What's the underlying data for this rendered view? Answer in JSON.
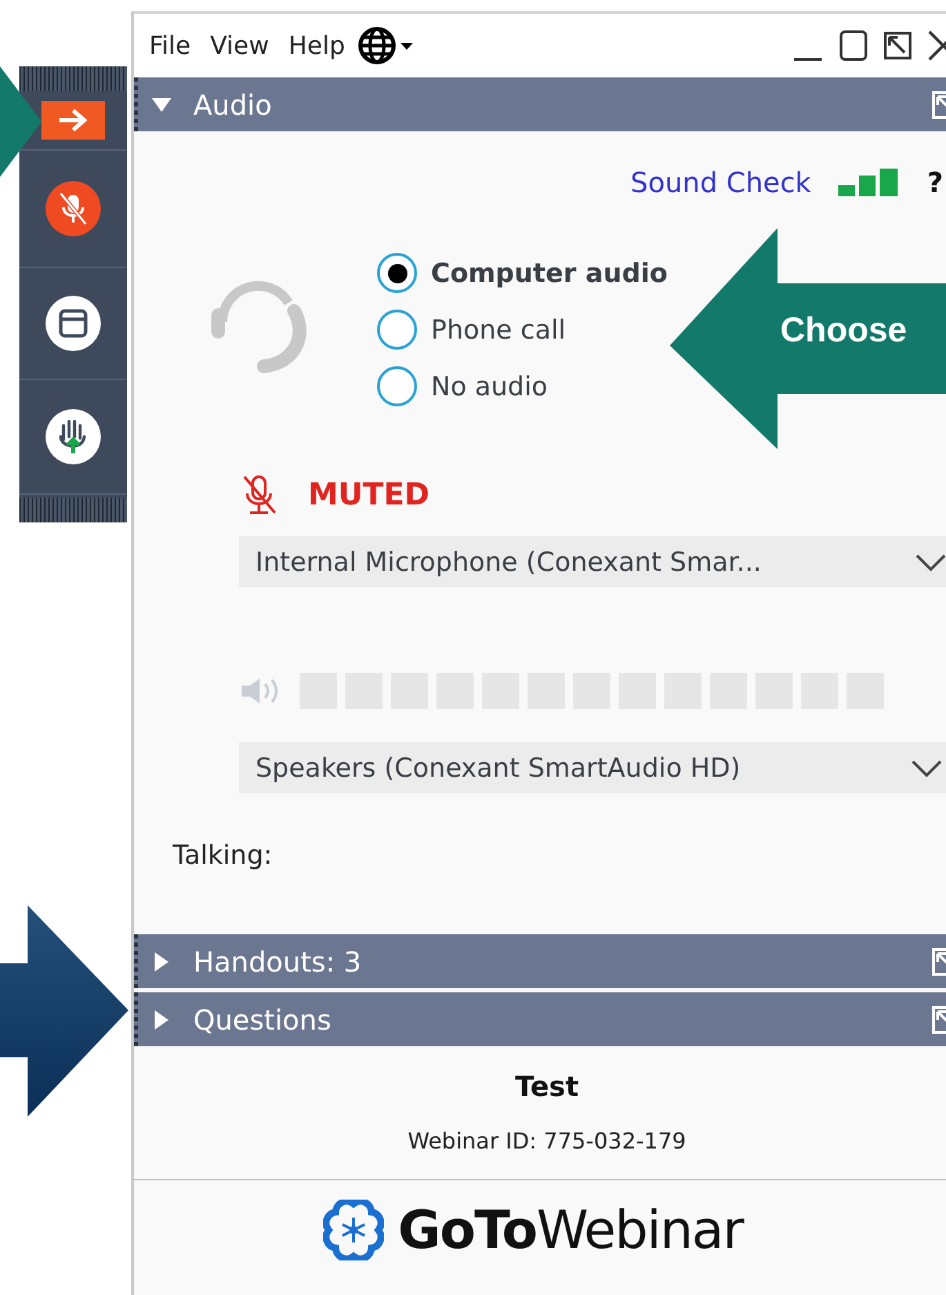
{
  "menu": [
    "File",
    "View",
    "Help"
  ],
  "sections": [
    {
      "title": "Audio",
      "expanded": true
    },
    {
      "title": "Handouts: 3",
      "expanded": false
    },
    {
      "title": "Questions",
      "expanded": false
    }
  ],
  "audio": {
    "sound_check": "Sound Check",
    "help": "?",
    "options": [
      {
        "label": "Computer audio",
        "selected": true
      },
      {
        "label": "Phone call",
        "selected": false
      },
      {
        "label": "No audio",
        "selected": false
      }
    ],
    "muted": true,
    "muted_label": "MUTED",
    "microphone": "Internal Microphone (Conexant Smar...",
    "speakers": "Speakers (Conexant SmartAudio HD)",
    "talking": "Talking:"
  },
  "webinar": {
    "title": "Test",
    "id": "Webinar ID: 775-032-179",
    "brand_bold": "GoTo",
    "brand_light": "Webinar"
  },
  "callout": "Choose"
}
